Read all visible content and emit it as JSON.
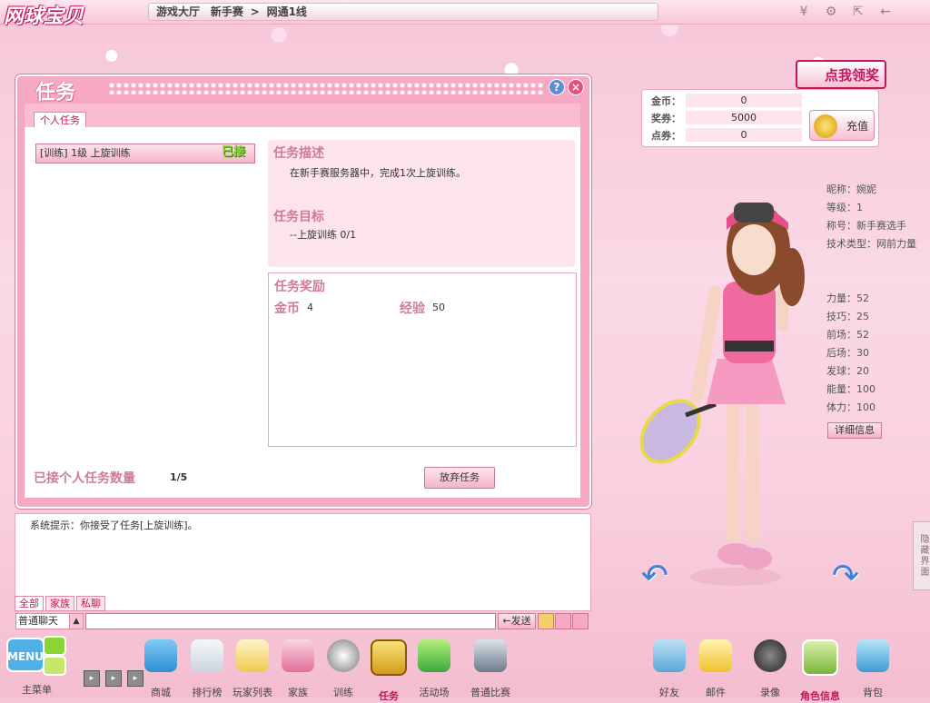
{
  "app": {
    "logo_text": "网球宝贝"
  },
  "breadcrumb": {
    "hall": "游戏大厅",
    "mode": "新手赛",
    "sep": ">",
    "server": "网通1线"
  },
  "task_window": {
    "title": "任务",
    "tab_personal": "个人任务",
    "list_item": {
      "text": "[训练] 1级  上旋训练",
      "badge": "已接"
    },
    "desc_heading": "任务描述",
    "desc_text": "在新手赛服务器中，完成1次上旋训练。",
    "goal_heading": "任务目标",
    "goal_text": "--上旋训练 0/1",
    "reward_heading": "任务奖励",
    "reward_coin_label": "金币",
    "reward_coin_value": "4",
    "reward_exp_label": "经验",
    "reward_exp_value": "50",
    "count_label": "已接个人任务数量",
    "count_value": "1/5",
    "abandon_label": "放弃任务"
  },
  "chat": {
    "message": "系统提示：你接受了任务[上旋训练]。",
    "tabs": [
      "全部",
      "家族",
      "私聊"
    ],
    "mode": "普通聊天",
    "send_label": "←发送"
  },
  "currency": {
    "gold_label": "金币：",
    "gold_value": "0",
    "ticket_label": "奖券：",
    "ticket_value": "5000",
    "points_label": "点券：",
    "points_value": "0",
    "recharge_label": "充值",
    "reward_button": "点我领奖"
  },
  "character": {
    "nickname": "昵称：婉妮",
    "level": "等级：1",
    "title": "称号：新手赛选手",
    "skill_type": "技术类型：网前力量",
    "power": "力量：52",
    "technique": "技巧：25",
    "forehand": "前场：52",
    "backhand": "后场：30",
    "serve": "发球：20",
    "energy": "能量：100",
    "stamina": "体力：100",
    "detail_label": "详细信息",
    "hide_ui": "隐藏界面"
  },
  "bottom_nav": {
    "menu": "主菜单",
    "items": [
      "商城",
      "排行榜",
      "玩家列表",
      "家族",
      "训练",
      "任务",
      "活动场",
      "普通比赛"
    ],
    "right_items": [
      "好友",
      "邮件",
      "录像",
      "角色信息",
      "背包"
    ]
  },
  "colors": {
    "accent": "#c2185b",
    "panel_pink": "#f7a8c4",
    "badge_green": "#8bd634"
  }
}
